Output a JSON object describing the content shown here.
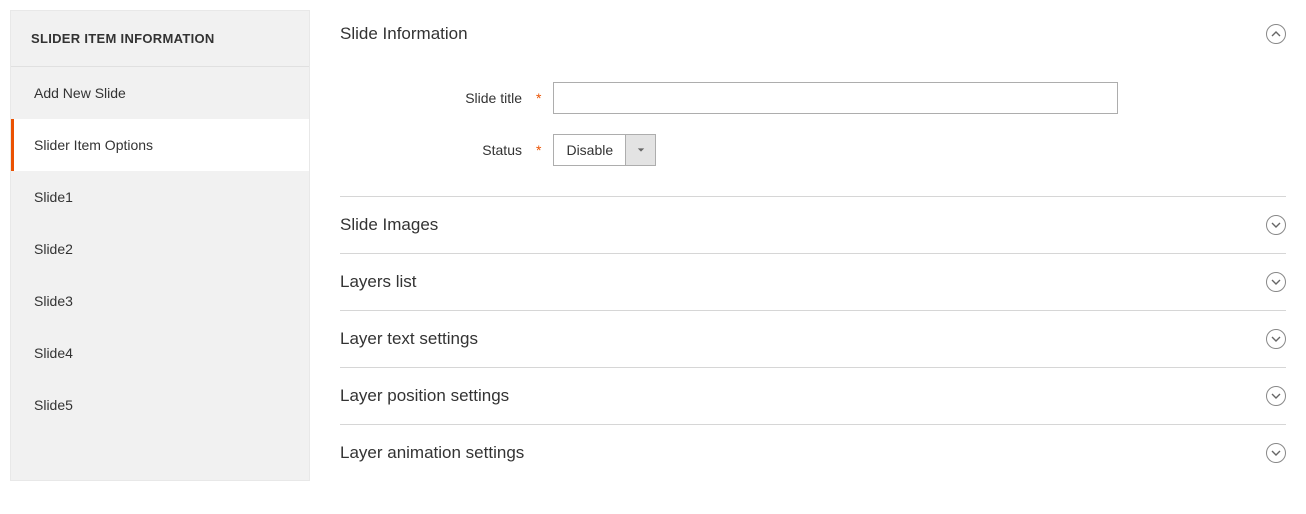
{
  "sidebar": {
    "header": "SLIDER ITEM INFORMATION",
    "items": [
      {
        "label": "Add New Slide",
        "active": false
      },
      {
        "label": "Slider Item Options",
        "active": true
      },
      {
        "label": "Slide1",
        "active": false
      },
      {
        "label": "Slide2",
        "active": false
      },
      {
        "label": "Slide3",
        "active": false
      },
      {
        "label": "Slide4",
        "active": false
      },
      {
        "label": "Slide5",
        "active": false
      }
    ]
  },
  "main": {
    "sections": {
      "slide_information": {
        "title": "Slide Information",
        "expanded": true,
        "fields": {
          "slide_title": {
            "label": "Slide title",
            "value": "",
            "required": true
          },
          "status": {
            "label": "Status",
            "value": "Disable",
            "required": true
          }
        }
      },
      "slide_images": {
        "title": "Slide Images",
        "expanded": false
      },
      "layers_list": {
        "title": "Layers list",
        "expanded": false
      },
      "layer_text_settings": {
        "title": "Layer text settings",
        "expanded": false
      },
      "layer_position_settings": {
        "title": "Layer position settings",
        "expanded": false
      },
      "layer_animation_settings": {
        "title": "Layer animation settings",
        "expanded": false
      }
    }
  },
  "required_mark": "*"
}
